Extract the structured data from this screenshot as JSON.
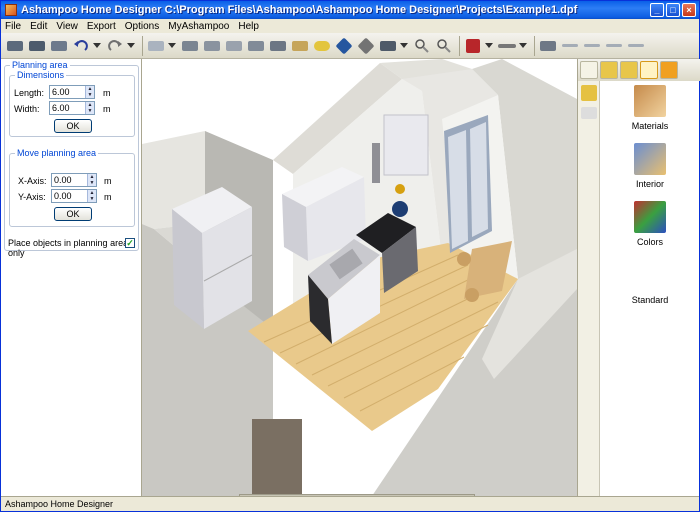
{
  "window": {
    "title": "Ashampoo Home Designer C:\\Program Files\\Ashampoo\\Ashampoo Home Designer\\Projects\\Example1.dpf",
    "min_glyph": "_",
    "max_glyph": "□",
    "close_glyph": "×"
  },
  "menu": [
    "File",
    "Edit",
    "View",
    "Export",
    "Options",
    "MyAshampoo",
    "Help"
  ],
  "toolbar": {
    "icons": [
      "open-file-icon",
      "save-icon",
      "print-icon",
      "undo-icon",
      "redo-icon",
      "floor-plan-icon",
      "wall-icon",
      "room-icon",
      "roof-icon",
      "window-icon",
      "door-icon",
      "stairs-icon",
      "light-icon",
      "move-icon",
      "rotate-icon",
      "slab-icon",
      "zoom-in-icon",
      "zoom-out-icon",
      "cube-view-icon",
      "level-icon",
      "dimension-icon",
      "measure-icon"
    ]
  },
  "planning_area": {
    "title": "Planning area",
    "dimensions": {
      "title": "Dimensions",
      "length_label": "Length:",
      "length_value": "6.00",
      "width_label": "Width:",
      "width_value": "6.00",
      "unit": "m",
      "ok_label": "OK"
    },
    "move": {
      "title": "Move planning area",
      "x_label": "X-Axis:",
      "x_value": "0.00",
      "y_label": "Y-Axis:",
      "y_value": "0.00",
      "unit": "m",
      "ok_label": "OK"
    },
    "place_only_label": "Place objects in planning area only",
    "place_only_checked": true
  },
  "catalog": {
    "items": [
      {
        "label": "Materials",
        "icon": "materials-icon"
      },
      {
        "label": "Interior",
        "icon": "interior-icon"
      },
      {
        "label": "Colors",
        "icon": "colors-icon"
      },
      {
        "label": "Standard",
        "icon": "standard-icon"
      }
    ]
  },
  "statusbar": {
    "text": "Ashampoo Home Designer"
  },
  "colors": {
    "titlebar": "#0a5fe8",
    "floor": "#e9c98b",
    "wall": "#d8d7d2",
    "cabinet": "#ebebef"
  }
}
